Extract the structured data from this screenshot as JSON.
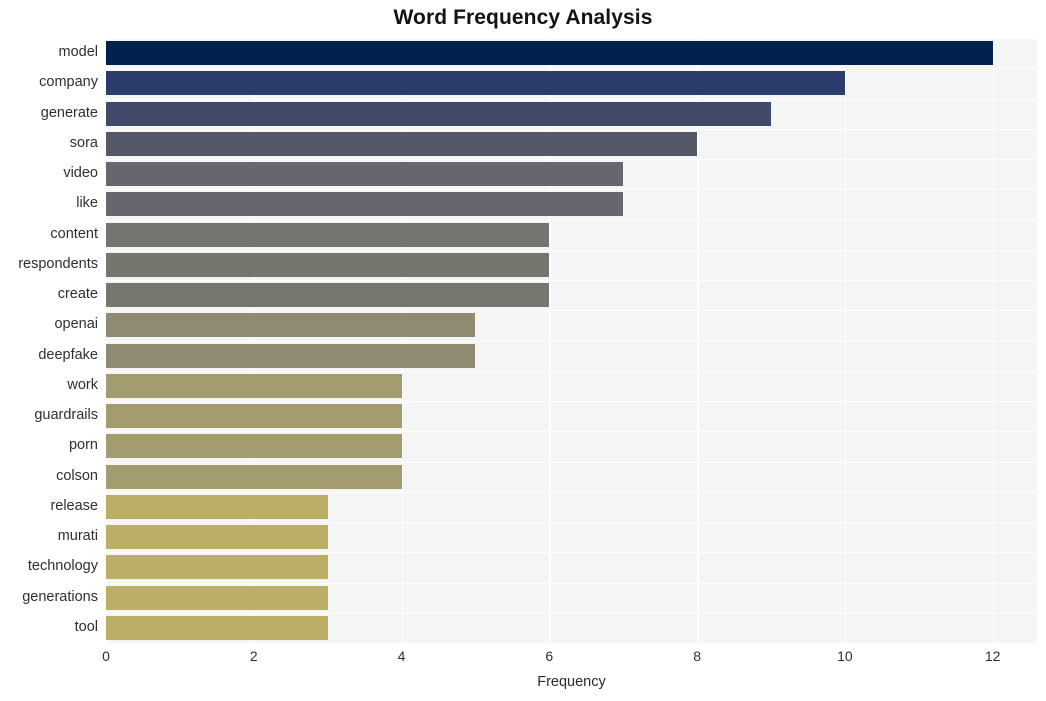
{
  "chart_data": {
    "type": "bar",
    "orientation": "horizontal",
    "title": "Word Frequency Analysis",
    "xlabel": "Frequency",
    "ylabel": "",
    "xlim": [
      0,
      12.6
    ],
    "ylim": [
      0,
      20
    ],
    "grid": true,
    "legend": null,
    "categories": [
      "model",
      "company",
      "generate",
      "sora",
      "video",
      "like",
      "content",
      "respondents",
      "create",
      "openai",
      "deepfake",
      "work",
      "guardrails",
      "porn",
      "colson",
      "release",
      "murati",
      "technology",
      "generations",
      "tool"
    ],
    "values": [
      12,
      10,
      9,
      8,
      7,
      7,
      6,
      6,
      6,
      5,
      5,
      4,
      4,
      4,
      4,
      3,
      3,
      3,
      3,
      3
    ],
    "bar_colors": [
      "#01224d",
      "#2c3c6b",
      "#414a69",
      "#545869",
      "#66676e",
      "#66676e",
      "#757570",
      "#76766f",
      "#77776f",
      "#908b73",
      "#8f8a72",
      "#a49c6e",
      "#a49c6e",
      "#a49c6e",
      "#a49c6e",
      "#bbae66",
      "#bbae66",
      "#bbae66",
      "#bbae66",
      "#bbae66"
    ],
    "xticks": [
      0,
      2,
      4,
      6,
      8,
      10,
      12
    ],
    "xtick_labels": [
      "0",
      "2",
      "4",
      "6",
      "8",
      "10",
      "12"
    ],
    "plot_background": "#f5f5f6",
    "grid_color": "#ffffff",
    "figure_background": "#ffffff"
  }
}
